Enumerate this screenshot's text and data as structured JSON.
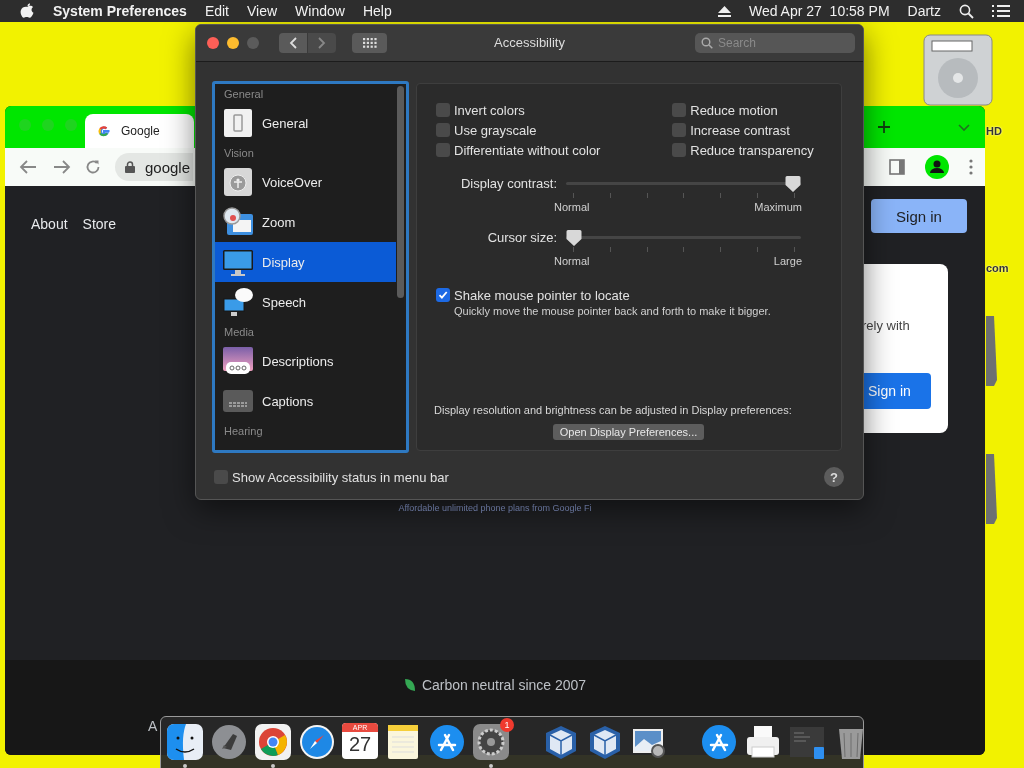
{
  "menu_bar": {
    "app": "System Preferences",
    "menus": [
      "Edit",
      "View",
      "Window",
      "Help"
    ],
    "clock": "Wed Apr 27  10:58 PM",
    "user": "Dartz"
  },
  "desktop": {
    "labels": [
      "HD",
      "com"
    ]
  },
  "browser": {
    "tab": "Google",
    "address": "google",
    "nav": [
      "About",
      "Store"
    ],
    "sign_in": "Sign in",
    "card": {
      "text": "rely with",
      "button": "Sign in"
    },
    "promo": "Affordable unlimited phone plans from Google Fi",
    "footer": "Carbon neutral since 2007",
    "footer_2": "A"
  },
  "window": {
    "title": "Accessibility",
    "search": {
      "placeholder": "Search"
    }
  },
  "sidebar": {
    "sections": [
      {
        "title": "General",
        "items": [
          {
            "label": "General",
            "kind": "switch",
            "selected": false
          }
        ]
      },
      {
        "title": "Vision",
        "items": [
          {
            "label": "VoiceOver",
            "kind": "voiceover",
            "selected": false
          },
          {
            "label": "Zoom",
            "kind": "zoom",
            "selected": false
          },
          {
            "label": "Display",
            "kind": "display",
            "selected": true
          },
          {
            "label": "Speech",
            "kind": "speech",
            "selected": false
          }
        ]
      },
      {
        "title": "Media",
        "items": [
          {
            "label": "Descriptions",
            "kind": "descriptions",
            "selected": false
          },
          {
            "label": "Captions",
            "kind": "captions",
            "selected": false
          }
        ]
      },
      {
        "title": "Hearing"
      }
    ]
  },
  "option_columns": [
    {
      "items": [
        {
          "label": "Invert colors",
          "checked": false
        },
        {
          "label": "Use grayscale",
          "checked": false
        },
        {
          "label": "Differentiate without color",
          "checked": false
        }
      ]
    },
    {
      "items": [
        {
          "label": "Reduce motion",
          "checked": false
        },
        {
          "label": "Increase contrast",
          "checked": false
        },
        {
          "label": "Reduce transparency",
          "checked": false
        }
      ]
    }
  ],
  "sliders": [
    {
      "label": "Display contrast:",
      "level": 1,
      "min_label": "Normal",
      "max_label": "Maximum"
    },
    {
      "label": "Cursor size:",
      "level": 0,
      "min_label": "Normal",
      "max_label": "Large"
    }
  ],
  "shake": {
    "label": "Shake mouse pointer to locate",
    "checked": true,
    "description": "Quickly move the mouse pointer back and forth to make it bigger."
  },
  "display_note": "Display resolution and brightness can be adjusted in Display preferences:",
  "display_button": "Open Display Preferences...",
  "status_option": {
    "label": "Show Accessibility status in menu bar",
    "checked": false
  },
  "help": "?",
  "dock": {
    "items": [
      {
        "kind": "finder",
        "running": true
      },
      {
        "kind": "launchpad",
        "running": false
      },
      {
        "kind": "chrome",
        "running": true
      },
      {
        "kind": "safari",
        "running": false
      },
      {
        "kind": "calendar",
        "month": "APR",
        "day": "27",
        "running": false
      },
      {
        "kind": "notes",
        "running": false
      },
      {
        "kind": "appstore",
        "running": false
      },
      {
        "kind": "settings",
        "badge": "1",
        "running": true
      },
      {
        "kind": "separator"
      },
      {
        "kind": "virtualbox",
        "running": false
      },
      {
        "kind": "virtualbox",
        "running": false
      },
      {
        "kind": "preview",
        "running": false
      },
      {
        "kind": "separator"
      },
      {
        "kind": "download",
        "running": false
      },
      {
        "kind": "printer",
        "running": false
      },
      {
        "kind": "screenshot",
        "running": false
      },
      {
        "kind": "trash",
        "running": false
      }
    ]
  }
}
